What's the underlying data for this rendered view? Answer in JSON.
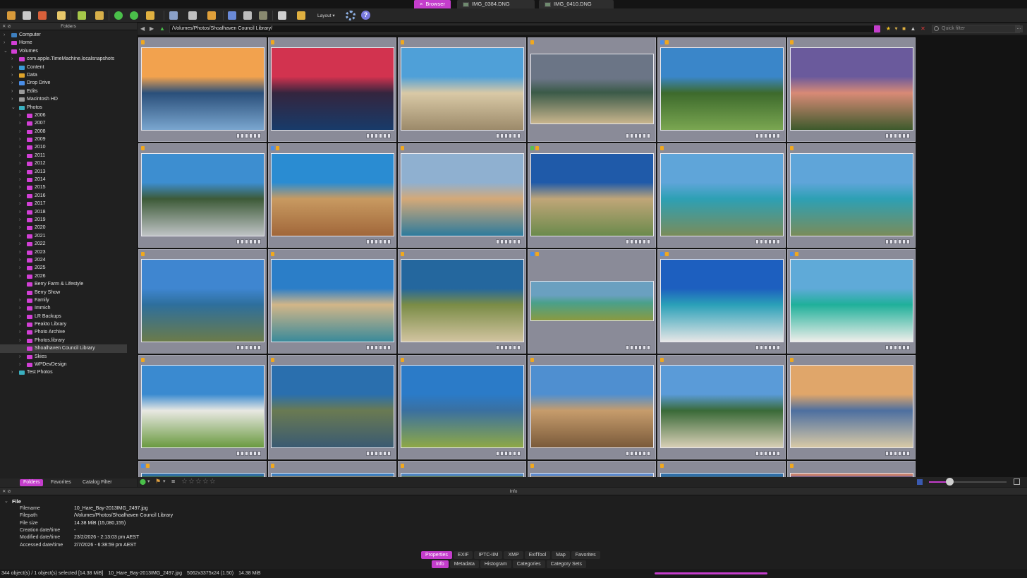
{
  "tabs": [
    {
      "label": "Browser",
      "active": true,
      "close": "×"
    },
    {
      "label": "IMG_0384.DNG",
      "active": false
    },
    {
      "label": "IMG_0410.DNG",
      "active": false
    }
  ],
  "toolbar": {
    "layout_label": "Layout"
  },
  "folders_panel": {
    "title": "Folders",
    "tree": [
      {
        "label": "Computer",
        "level": 0,
        "expanded": false,
        "icon_color": "#3d7fbf"
      },
      {
        "label": "Home",
        "level": 0,
        "expanded": false,
        "icon_color": "#d23fd6"
      },
      {
        "label": "Volumes",
        "level": 0,
        "expanded": true,
        "icon_color": "#d23fd6"
      },
      {
        "label": "com.apple.TimeMachine.localsnapshots",
        "level": 1,
        "expanded": false,
        "icon_color": "#d23fd6"
      },
      {
        "label": "Content",
        "level": 1,
        "expanded": false,
        "icon_color": "#3a9ad6"
      },
      {
        "label": "Data",
        "level": 1,
        "expanded": false,
        "icon_color": "#e0a42a"
      },
      {
        "label": "Drop Drive",
        "level": 1,
        "expanded": false,
        "icon_color": "#4a8ee8"
      },
      {
        "label": "Edits",
        "level": 1,
        "expanded": false,
        "icon_color": "#9a9a9a"
      },
      {
        "label": "Macintosh HD",
        "level": 1,
        "expanded": false,
        "icon_color": "#9a9a9a"
      },
      {
        "label": "Photos",
        "level": 1,
        "expanded": true,
        "icon_color": "#3ab0c0"
      },
      {
        "label": "2006",
        "level": 2,
        "expanded": false,
        "icon_color": "#d23fd6"
      },
      {
        "label": "2007",
        "level": 2,
        "expanded": false,
        "icon_color": "#d23fd6"
      },
      {
        "label": "2008",
        "level": 2,
        "expanded": false,
        "icon_color": "#d23fd6"
      },
      {
        "label": "2009",
        "level": 2,
        "expanded": false,
        "icon_color": "#d23fd6"
      },
      {
        "label": "2010",
        "level": 2,
        "expanded": false,
        "icon_color": "#d23fd6"
      },
      {
        "label": "2011",
        "level": 2,
        "expanded": false,
        "icon_color": "#d23fd6"
      },
      {
        "label": "2012",
        "level": 2,
        "expanded": false,
        "icon_color": "#d23fd6"
      },
      {
        "label": "2013",
        "level": 2,
        "expanded": false,
        "icon_color": "#d23fd6"
      },
      {
        "label": "2014",
        "level": 2,
        "expanded": false,
        "icon_color": "#d23fd6"
      },
      {
        "label": "2015",
        "level": 2,
        "expanded": false,
        "icon_color": "#d23fd6"
      },
      {
        "label": "2016",
        "level": 2,
        "expanded": false,
        "icon_color": "#d23fd6"
      },
      {
        "label": "2017",
        "level": 2,
        "expanded": false,
        "icon_color": "#d23fd6"
      },
      {
        "label": "2018",
        "level": 2,
        "expanded": false,
        "icon_color": "#d23fd6"
      },
      {
        "label": "2019",
        "level": 2,
        "expanded": false,
        "icon_color": "#d23fd6"
      },
      {
        "label": "2020",
        "level": 2,
        "expanded": false,
        "icon_color": "#d23fd6"
      },
      {
        "label": "2021",
        "level": 2,
        "expanded": false,
        "icon_color": "#d23fd6"
      },
      {
        "label": "2022",
        "level": 2,
        "expanded": false,
        "icon_color": "#d23fd6"
      },
      {
        "label": "2023",
        "level": 2,
        "expanded": false,
        "icon_color": "#d23fd6"
      },
      {
        "label": "2024",
        "level": 2,
        "expanded": false,
        "icon_color": "#d23fd6"
      },
      {
        "label": "2025",
        "level": 2,
        "expanded": false,
        "icon_color": "#d23fd6"
      },
      {
        "label": "2026",
        "level": 2,
        "expanded": false,
        "icon_color": "#d23fd6"
      },
      {
        "label": "Berry Farm & Lifestyle",
        "level": 2,
        "expanded": null,
        "icon_color": "#d23fd6"
      },
      {
        "label": "Berry Show",
        "level": 2,
        "expanded": null,
        "icon_color": "#d23fd6"
      },
      {
        "label": "Family",
        "level": 2,
        "expanded": false,
        "icon_color": "#d23fd6"
      },
      {
        "label": "Immich",
        "level": 2,
        "expanded": false,
        "icon_color": "#d23fd6"
      },
      {
        "label": "LR Backups",
        "level": 2,
        "expanded": false,
        "icon_color": "#d23fd6"
      },
      {
        "label": "Peakto Library",
        "level": 2,
        "expanded": false,
        "icon_color": "#d23fd6"
      },
      {
        "label": "Photo Archive",
        "level": 2,
        "expanded": false,
        "icon_color": "#d23fd6"
      },
      {
        "label": "Photos.library",
        "level": 2,
        "expanded": false,
        "icon_color": "#d23fd6"
      },
      {
        "label": "Shoalhaven Council Library",
        "level": 2,
        "expanded": null,
        "selected": true,
        "icon_color": "#d23fd6"
      },
      {
        "label": "Skies",
        "level": 2,
        "expanded": false,
        "icon_color": "#d23fd6"
      },
      {
        "label": "WPDevDesign",
        "level": 2,
        "expanded": false,
        "icon_color": "#d23fd6"
      },
      {
        "label": "Test Photos",
        "level": 1,
        "expanded": false,
        "icon_color": "#3ab0c0"
      }
    ],
    "bottom_tabs": [
      {
        "label": "Folders",
        "active": true
      },
      {
        "label": "Favorites",
        "active": false
      },
      {
        "label": "Catalog Filter",
        "active": false
      }
    ]
  },
  "pathbar": {
    "path": "/Volumes/Photos/Shoalhaven Council Library/",
    "quick_filter_placeholder": "Quick filter"
  },
  "thumbnails": [
    {
      "name": "sunset-bay-mountain",
      "colors": [
        "#f2a24e",
        "#2a4f7a",
        "#7aa6cf"
      ],
      "orientation": "land"
    },
    {
      "name": "red-sunset-lake",
      "colors": [
        "#d2334f",
        "#34253e",
        "#183b6a"
      ],
      "orientation": "land"
    },
    {
      "name": "beach-path-fence",
      "colors": [
        "#4fa0d8",
        "#d9c9a6",
        "#9c8a6a"
      ],
      "orientation": "land"
    },
    {
      "name": "aerial-sandbar-clouds",
      "colors": [
        "#6b7586",
        "#3a5a48",
        "#c9b58d"
      ],
      "orientation": "wide"
    },
    {
      "name": "coastal-bush-beach",
      "colors": [
        "#3a86c9",
        "#3d6a2c",
        "#7aa651"
      ],
      "orientation": "land"
    },
    {
      "name": "dunes-grass-twilight",
      "colors": [
        "#6a5a9c",
        "#d88a76",
        "#3d5a2c"
      ],
      "orientation": "land"
    },
    {
      "name": "aerial-caravan-park",
      "colors": [
        "#3d8ed0",
        "#3d5a38",
        "#bfc3c5"
      ],
      "orientation": "land"
    },
    {
      "name": "rocks-beach-sky",
      "colors": [
        "#2a8cd2",
        "#c89a61",
        "#a1673a"
      ],
      "orientation": "land"
    },
    {
      "name": "aerial-surf-beach",
      "colors": [
        "#8fb0d0",
        "#d4a978",
        "#2e7b9c"
      ],
      "orientation": "land"
    },
    {
      "name": "dune-grass-blue-sky",
      "colors": [
        "#1f5aa9",
        "#c0a678",
        "#6b8a4c"
      ],
      "orientation": "land"
    },
    {
      "name": "aerial-lagoon-1",
      "colors": [
        "#5fa5d9",
        "#2da0b4",
        "#7a8c5a"
      ],
      "orientation": "land"
    },
    {
      "name": "aerial-lagoon-2",
      "colors": [
        "#5fa5d9",
        "#2da0b4",
        "#7a8c5a"
      ],
      "orientation": "land"
    },
    {
      "name": "aerial-coast-town",
      "colors": [
        "#3f86d0",
        "#2e6f9c",
        "#6b7b4a"
      ],
      "orientation": "land"
    },
    {
      "name": "cove-sand-clear-water",
      "colors": [
        "#2b7ec8",
        "#d2b688",
        "#3a8a9a"
      ],
      "orientation": "land"
    },
    {
      "name": "aerial-spit-sea",
      "colors": [
        "#24679e",
        "#7a8c46",
        "#d2c4a0"
      ],
      "orientation": "land"
    },
    {
      "name": "reef-clear-shallows",
      "colors": [
        "#6aa0c0",
        "#4aa08a",
        "#8a9a40"
      ],
      "orientation": "wide"
    },
    {
      "name": "white-beach-blue-sky",
      "colors": [
        "#1d5fbf",
        "#2aa0b8",
        "#e6e6e6"
      ],
      "orientation": "land"
    },
    {
      "name": "turquoise-shoreline",
      "colors": [
        "#5faad8",
        "#1fb09a",
        "#eeeeea"
      ],
      "orientation": "land"
    },
    {
      "name": "dunes-blue-sky",
      "colors": [
        "#3a8ad0",
        "#e8e8e2",
        "#6a9a40"
      ],
      "orientation": "land"
    },
    {
      "name": "rock-platform-pool",
      "colors": [
        "#2a6fae",
        "#6a7a52",
        "#3a5a72"
      ],
      "orientation": "land"
    },
    {
      "name": "headland-grass-sea",
      "colors": [
        "#2b7bc8",
        "#3a70a0",
        "#8ea846"
      ],
      "orientation": "land"
    },
    {
      "name": "sand-channel-beach",
      "colors": [
        "#4f8fd0",
        "#c69c6c",
        "#7a5a3a"
      ],
      "orientation": "land"
    },
    {
      "name": "forest-beach-walkers",
      "colors": [
        "#5a9bd8",
        "#3a6a38",
        "#d8cfb6"
      ],
      "orientation": "land"
    },
    {
      "name": "dune-sunset-grass",
      "colors": [
        "#e0a66a",
        "#4d6fa0",
        "#d8c9a6"
      ],
      "orientation": "land"
    },
    {
      "name": "row5-1",
      "colors": [
        "#2f6fa8",
        "#3e6a4a",
        "#888888"
      ],
      "orientation": "land"
    },
    {
      "name": "row5-2",
      "colors": [
        "#3b7fc2",
        "#9a8a6a",
        "#888888"
      ],
      "orientation": "land"
    },
    {
      "name": "row5-3",
      "colors": [
        "#4f86c4",
        "#6a7a4a",
        "#888888"
      ],
      "orientation": "land"
    },
    {
      "name": "row5-4",
      "colors": [
        "#5c8ad0",
        "#9c8a6a",
        "#888888"
      ],
      "orientation": "land"
    },
    {
      "name": "row5-5",
      "colors": [
        "#2f6fa8",
        "#3a6a8a",
        "#888888"
      ],
      "orientation": "land"
    },
    {
      "name": "row5-6",
      "colors": [
        "#c9826e",
        "#6a5a8a",
        "#888888"
      ],
      "orientation": "land"
    }
  ],
  "info_panel": {
    "title": "Info",
    "section": "File",
    "rows": [
      {
        "label": "Filename",
        "value": "10_Hare_Bay-2013IMG_2497.jpg"
      },
      {
        "label": "Filepath",
        "value": "/Volumes/Photos/Shoalhaven Council Library"
      },
      {
        "label": "File size",
        "value": "14.38 MiB (15,080,155)"
      },
      {
        "label": "Creation date/time",
        "value": "-"
      },
      {
        "label": "Modified date/time",
        "value": "23/2/2026 - 2:13:03 pm AEST"
      },
      {
        "label": "Accessed date/time",
        "value": "2/7/2026 - 6:38:59 pm AEST"
      }
    ],
    "tabs_top": [
      {
        "label": "Properties",
        "active": true
      },
      {
        "label": "EXIF",
        "active": false
      },
      {
        "label": "IPTC-IIM",
        "active": false
      },
      {
        "label": "XMP",
        "active": false
      },
      {
        "label": "ExifTool",
        "active": false
      },
      {
        "label": "Map",
        "active": false
      },
      {
        "label": "Favorites",
        "active": false
      }
    ],
    "tabs_bottom": [
      {
        "label": "Info",
        "active": true
      },
      {
        "label": "Metadata",
        "active": false
      },
      {
        "label": "Histogram",
        "active": false
      },
      {
        "label": "Categories",
        "active": false
      },
      {
        "label": "Category Sets",
        "active": false
      }
    ]
  },
  "status": {
    "objects": "344 object(s) / 1 object(s) selected [14.38 MiB]",
    "filename": "10_Hare_Bay-2013IMG_2497.jpg",
    "dimensions": "5062x3375x24 (1.50)",
    "size": "14.38 MiB"
  },
  "zoom_slider_fraction": 0.26,
  "accent": "#c43dcc"
}
